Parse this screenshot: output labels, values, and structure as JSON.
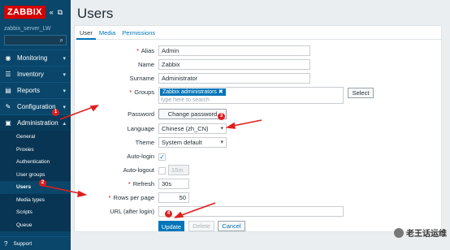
{
  "sidebar": {
    "logo": "ZABBIX",
    "collapse_icon": "«",
    "fullscreen_icon": "⧉",
    "server_name": "zabbix_server_LW",
    "search_icon": "⌕",
    "menu": [
      {
        "label": "Monitoring",
        "icon": "◉"
      },
      {
        "label": "Inventory",
        "icon": "☰"
      },
      {
        "label": "Reports",
        "icon": "▤"
      },
      {
        "label": "Configuration",
        "icon": "🔧"
      },
      {
        "label": "Administration",
        "icon": "▣"
      }
    ],
    "submenu": [
      "General",
      "Proxies",
      "Authentication",
      "User groups",
      "Users",
      "Media types",
      "Scripts",
      "Queue"
    ],
    "support": {
      "label": "Support",
      "icon": "?"
    }
  },
  "page": {
    "title": "Users"
  },
  "tabs": [
    "User",
    "Media",
    "Permissions"
  ],
  "form": {
    "alias": {
      "label": "Alias",
      "value": "Admin"
    },
    "name": {
      "label": "Name",
      "value": "Zabbix"
    },
    "surname": {
      "label": "Surname",
      "value": "Administrator"
    },
    "groups": {
      "label": "Groups",
      "chip": "Zabbix administrators",
      "chip_remove": "✖",
      "placeholder": "type here to search",
      "select_button": "Select"
    },
    "password": {
      "label": "Password",
      "button": "Change password"
    },
    "language": {
      "label": "Language",
      "value": "Chinese (zh_CN)"
    },
    "theme": {
      "label": "Theme",
      "value": "System default"
    },
    "autologin": {
      "label": "Auto-login",
      "check": "✓"
    },
    "autologout": {
      "label": "Auto-logout",
      "value": "15m"
    },
    "refresh": {
      "label": "Refresh",
      "value": "30s"
    },
    "rows_per_page": {
      "label": "Rows per page",
      "value": "50"
    },
    "url": {
      "label": "URL (after login)",
      "value": ""
    },
    "required_mark": "*",
    "buttons": {
      "update": "Update",
      "delete": "Delete",
      "cancel": "Cancel"
    }
  },
  "annotations": [
    "1",
    "2",
    "3",
    "4"
  ],
  "watermark": "老王话运维"
}
